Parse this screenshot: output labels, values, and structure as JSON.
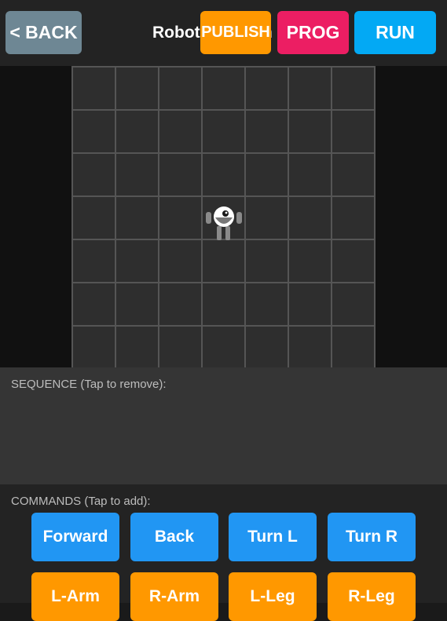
{
  "header": {
    "title": "Robot Program",
    "back_label": "< BACK",
    "publish_label": "PUBLISH",
    "prog_label": "PROG",
    "run_label": "RUN"
  },
  "sequence": {
    "label": "SEQUENCE (Tap to remove):",
    "items": []
  },
  "commands": {
    "label": "COMMANDS (Tap to add):",
    "row1": [
      "Forward",
      "Back",
      "Turn L",
      "Turn R"
    ],
    "row2": [
      "L-Arm",
      "R-Arm",
      "L-Leg",
      "R-Leg"
    ]
  },
  "grid": {
    "rows": 7,
    "cols": 7,
    "robot_cell": [
      3,
      3
    ]
  },
  "colors": {
    "back": "#6e8794",
    "publish": "#ff9800",
    "prog": "#ec1e63",
    "run": "#03a9f4",
    "command_blue": "#2196f3",
    "command_orange": "#ff9800"
  }
}
